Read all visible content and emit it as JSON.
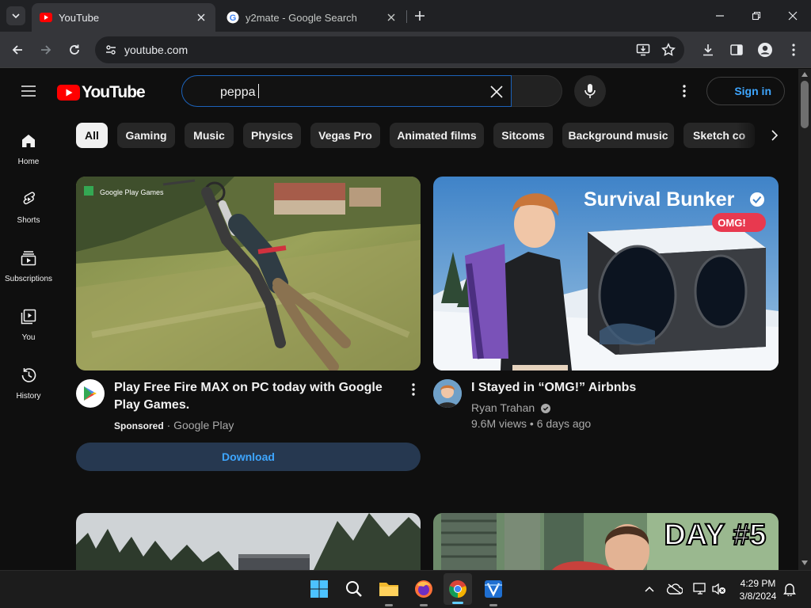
{
  "browser": {
    "tabs": [
      {
        "title": "YouTube",
        "active": true
      },
      {
        "title": "y2mate - Google Search",
        "active": false
      }
    ],
    "url": "youtube.com"
  },
  "youtube": {
    "logo_text": "YouTube",
    "search_query": "peppa",
    "sign_in": "Sign in",
    "guide": [
      {
        "label": "Home",
        "icon": "home-icon"
      },
      {
        "label": "Shorts",
        "icon": "shorts-icon"
      },
      {
        "label": "Subscriptions",
        "icon": "subscriptions-icon"
      },
      {
        "label": "You",
        "icon": "you-icon"
      },
      {
        "label": "History",
        "icon": "history-icon"
      }
    ],
    "chips": [
      "All",
      "Gaming",
      "Music",
      "Physics",
      "Vegas Pro",
      "Animated films",
      "Sitcoms",
      "Background music",
      "Sketch co"
    ],
    "videos": [
      {
        "title": "Play Free Fire MAX on PC today with Google Play Games.",
        "sponsored": "Sponsored",
        "channel": "Google Play",
        "cta": "Download",
        "thumb_badge": "Google Play Games"
      },
      {
        "title": "I Stayed in “OMG!” Airbnbs",
        "channel": "Ryan Trahan",
        "views": "9.6M views",
        "age": "6 days ago",
        "thumb_text": "Survival Bunker",
        "thumb_badge": "OMG!"
      },
      {
        "thumb_text": ""
      },
      {
        "thumb_text": "DAY #5"
      }
    ]
  },
  "taskbar": {
    "time": "4:29 PM",
    "date": "3/8/2024"
  },
  "colors": {
    "youtube_red": "#ff0000",
    "link_blue": "#3ea6ff",
    "background": "#0f0f0f"
  }
}
